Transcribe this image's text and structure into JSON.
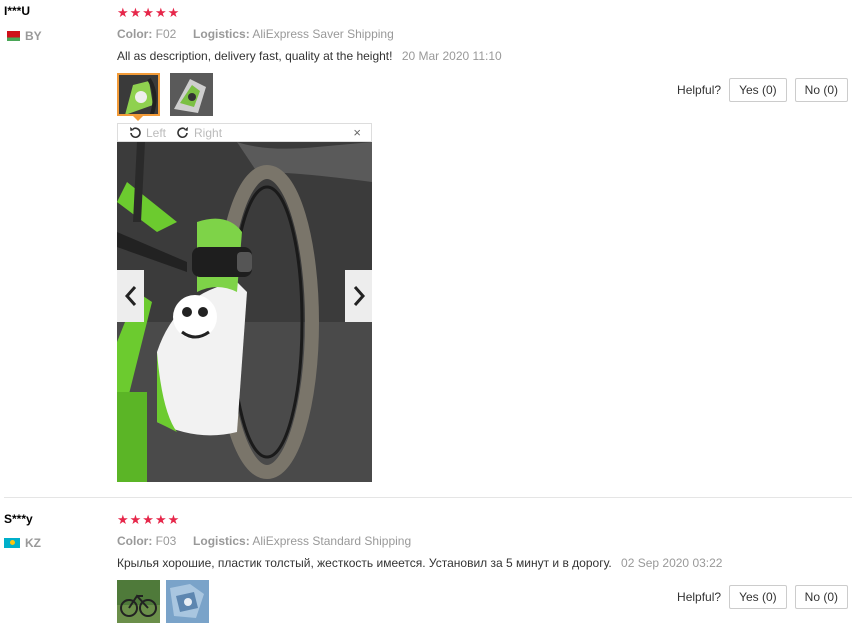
{
  "reviews": [
    {
      "user": "I***U",
      "country": "BY",
      "stars": "★★★★★",
      "color_label": "Color:",
      "color_value": "F02",
      "logistics_label": "Logistics:",
      "logistics_value": "AliExpress Saver Shipping",
      "text": "All as description, delivery fast, quality at the height!",
      "date": "20 Mar 2020 11:10",
      "helpful_label": "Helpful?",
      "yes_label": "Yes (0)",
      "no_label": "No (0)"
    },
    {
      "user": "S***y",
      "country": "KZ",
      "stars": "★★★★★",
      "color_label": "Color:",
      "color_value": "F03",
      "logistics_label": "Logistics:",
      "logistics_value": "AliExpress Standard Shipping",
      "text": "Крылья хорошие, пластик толстый, жесткость имеется. Установил за 5 минут и в дорогу.",
      "date": "02 Sep 2020 03:22",
      "helpful_label": "Helpful?",
      "yes_label": "Yes (0)",
      "no_label": "No (0)"
    }
  ],
  "viewer": {
    "rotate_left": "Left",
    "rotate_right": "Right",
    "close": "×",
    "prev": "‹",
    "next": "›"
  }
}
